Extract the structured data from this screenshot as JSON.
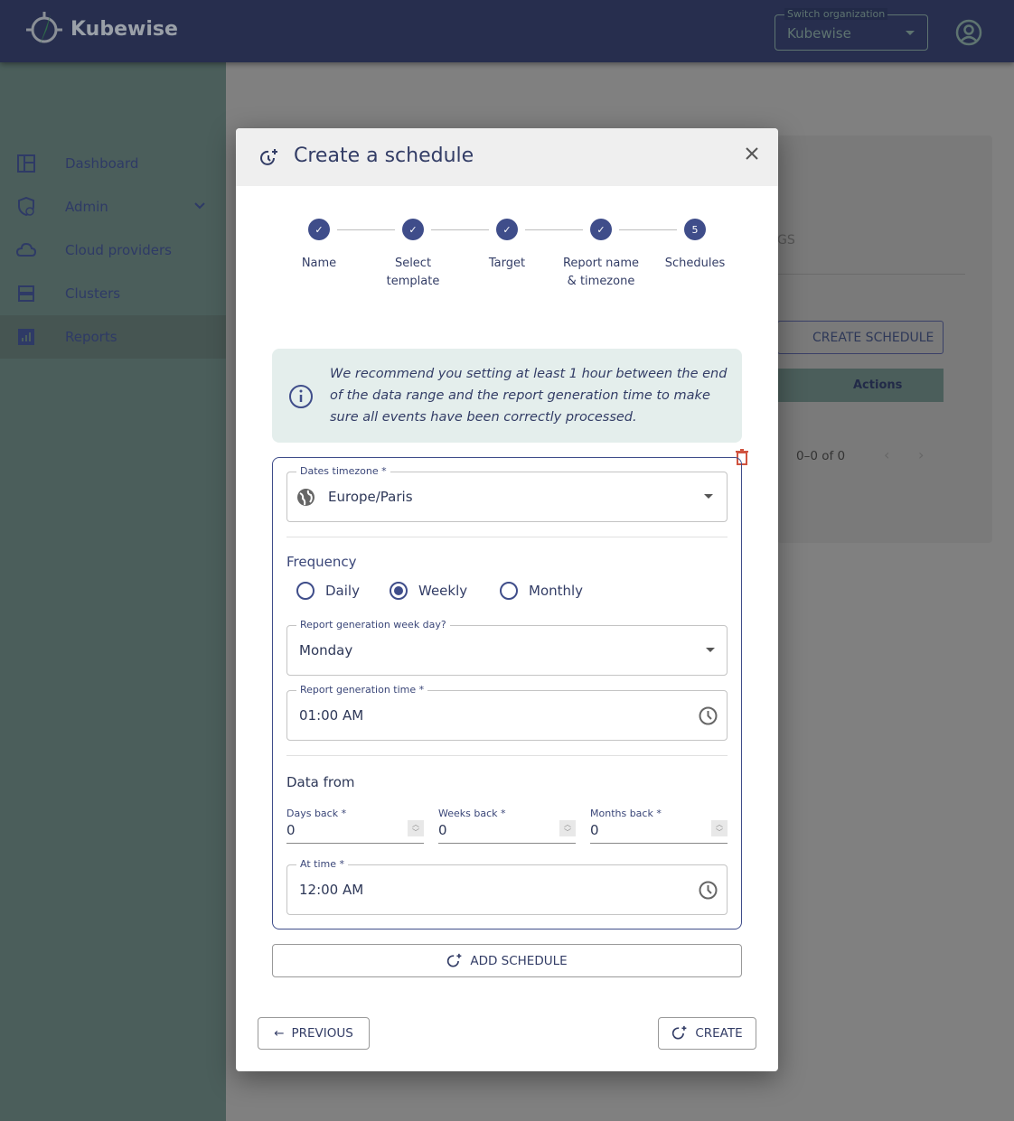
{
  "app": {
    "brand": "Kubewise"
  },
  "org_switcher": {
    "label": "Switch organization",
    "value": "Kubewise"
  },
  "sidebar": {
    "items": [
      {
        "label": "Dashboard"
      },
      {
        "label": "Admin"
      },
      {
        "label": "Cloud providers"
      },
      {
        "label": "Clusters"
      },
      {
        "label": "Reports"
      }
    ]
  },
  "background_page": {
    "tab_fragment": "GS",
    "create_schedule": "CREATE SCHEDULE",
    "actions_header": "Actions",
    "pagination": "0–0 of 0"
  },
  "modal": {
    "title": "Create a schedule",
    "steps": [
      {
        "label": "Name",
        "state": "done"
      },
      {
        "label": "Select template",
        "state": "done"
      },
      {
        "label": "Target",
        "state": "done"
      },
      {
        "label": "Report name & timezone",
        "state": "done"
      },
      {
        "label": "Schedules",
        "number": "5",
        "state": "active"
      }
    ],
    "info": "We recommend you setting at least 1 hour between the end of the data range and the report generation time to make sure all events have been correctly processed.",
    "timezone": {
      "label": "Dates timezone *",
      "value": "Europe/Paris"
    },
    "frequency": {
      "label": "Frequency",
      "options": [
        "Daily",
        "Weekly",
        "Monthly"
      ],
      "selected": "Weekly"
    },
    "weekday": {
      "label": "Report generation week day?",
      "value": "Monday"
    },
    "gen_time": {
      "label": "Report generation time *",
      "value": "01:00 AM"
    },
    "data_from": {
      "label": "Data from",
      "days": {
        "label": "Days back *",
        "value": "0"
      },
      "weeks": {
        "label": "Weeks back *",
        "value": "0"
      },
      "months": {
        "label": "Months back *",
        "value": "0"
      },
      "at_time": {
        "label": "At time *",
        "value": "12:00 AM"
      }
    },
    "add_schedule": "ADD SCHEDULE",
    "previous": "PREVIOUS",
    "create": "CREATE"
  },
  "colors": {
    "primary": "#3f4d8a",
    "delete": "#d0533f",
    "info_bg": "#e4eeec"
  }
}
